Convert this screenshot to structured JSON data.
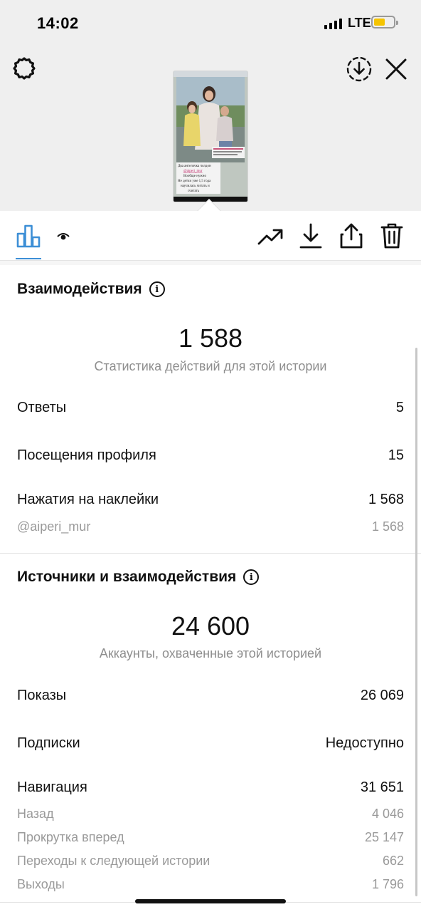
{
  "status_bar": {
    "time": "14:02",
    "network": "LTE",
    "battery_color": "#f5c400"
  },
  "top_bar": {
    "settings_icon": "gear-icon",
    "download_icon": "download-circle-icon",
    "close_icon": "close-icon"
  },
  "story_thumbnail": {
    "lines": [
      "Два ангелочка чолдон",
      "@aiperi_mur",
      "Вообще нужно",
      "Не детки уже 1,5 года",
      "научилась читать и",
      "считать"
    ]
  },
  "tabs": {
    "insights_icon": "bar-chart-icon",
    "viewers_icon": "eye-icon",
    "promote_icon": "trending-up-icon",
    "save_icon": "download-icon",
    "share_icon": "share-icon",
    "delete_icon": "trash-icon"
  },
  "interactions": {
    "title": "Взаимодействия",
    "total": "1 588",
    "caption": "Статистика действий для этой истории",
    "rows": [
      {
        "label": "Ответы",
        "value": "5"
      },
      {
        "label": "Посещения профиля",
        "value": "15"
      },
      {
        "label": "Нажатия на наклейки",
        "value": "1 568"
      }
    ],
    "sub_rows": [
      {
        "label": "@aiperi_mur",
        "value": "1 568"
      }
    ]
  },
  "discovery": {
    "title": "Источники и взаимодействия",
    "total": "24 600",
    "caption": "Аккаунты, охваченные этой историей",
    "rows": [
      {
        "label": "Показы",
        "value": "26 069"
      },
      {
        "label": "Подписки",
        "value": "Недоступно"
      },
      {
        "label": "Навигация",
        "value": "31 651"
      }
    ],
    "sub_rows": [
      {
        "label": "Назад",
        "value": "4 046"
      },
      {
        "label": "Прокрутка вперед",
        "value": "25 147"
      },
      {
        "label": "Переходы к следующей истории",
        "value": "662"
      },
      {
        "label": "Выходы",
        "value": "1 796"
      }
    ]
  },
  "accent_color": "#3d8fd6"
}
